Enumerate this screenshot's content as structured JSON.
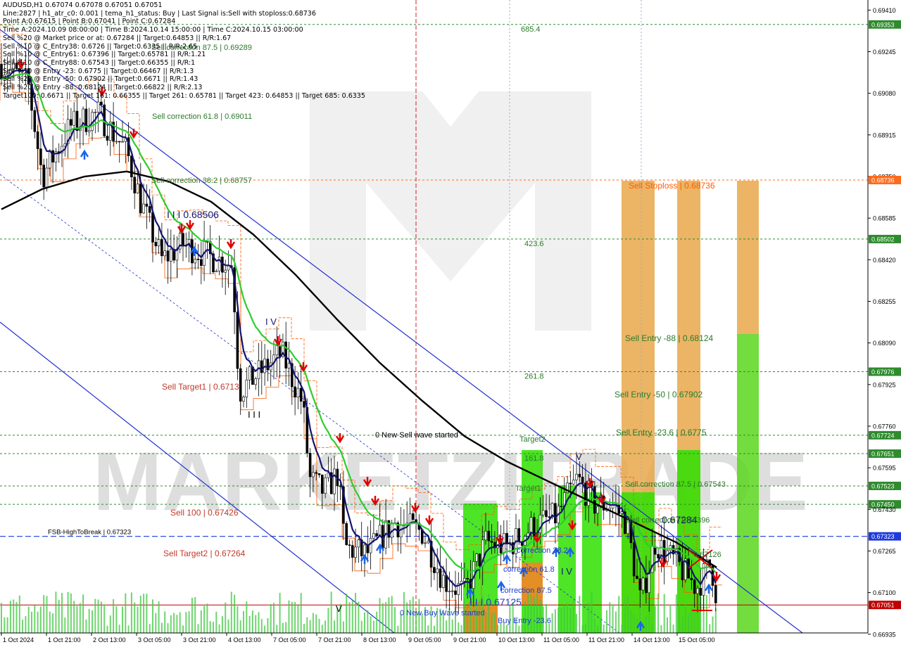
{
  "header": {
    "lines": [
      "AUDUSD,H1  0.67074 0.67078 0.67051 0.67051",
      "Line:2827  | h1_atr_c0: 0.001  | tema_h1_status: Buy  | Last Signal is:Sell with stoploss:0.68736",
      "Point A:0.67615 | Point B:0.67041 | Point C:0.67284",
      "Time A:2024.10.09 08:00:00 | Time B:2024.10.14 15:00:00 | Time C:2024.10.15 03:00:00",
      "Sell %20 @ Market price or at: 0.67284 || Target:0.64853 || R/R:1.67",
      "Sell %10 @ C_Entry38: 0.6726 || Target:0.6335 || R/R:2.65",
      "Sell %10 @ C_Entry61: 0.67396 || Target:0.65781 || R/R:1.21",
      "Sell %10 @ C_Entry88: 0.67543 || Target:0.66355 || R/R:1",
      "Sell %10 @ Entry -23: 0.6775 || Target:0.66467 || R/R:1.3",
      "Sell %20 @ Entry -50: 0.67902 || Target:0.6671 || R/R:1.43",
      "Sell %20 @ Entry -88: 0.68124 || Target:0.66822 || R/R:2.13",
      "Target100: 0.6671 || Target 161: 0.66355 || Target 261: 0.65781 || Target 423: 0.64853 || Target 685: 0.6335"
    ]
  },
  "chart_data": {
    "type": "candlestick",
    "symbol": "AUDUSD",
    "timeframe": "H1",
    "ylim": [
      0.6694,
      0.6945
    ],
    "price_ticks": [
      "0.69410",
      "0.69353",
      "0.69245",
      "0.69080",
      "0.68915",
      "0.68750",
      "0.68736",
      "0.68585",
      "0.68502",
      "0.68420",
      "0.68255",
      "0.68090",
      "0.67976",
      "0.67925",
      "0.67760",
      "0.67724",
      "0.67651",
      "0.67595",
      "0.67523",
      "0.67450",
      "0.67430",
      "0.67323",
      "0.67265",
      "0.67100",
      "0.67051",
      "0.66935"
    ],
    "x_ticks": [
      "1 Oct 2024",
      "1 Oct 21:00",
      "2 Oct 13:00",
      "3 Oct 05:00",
      "3 Oct 21:00",
      "4 Oct 13:00",
      "7 Oct 05:00",
      "7 Oct 21:00",
      "8 Oct 13:00",
      "9 Oct 05:00",
      "9 Oct 21:00",
      "10 Oct 13:00",
      "11 Oct 05:00",
      "11 Oct 21:00",
      "14 Oct 13:00",
      "15 Oct 05:00"
    ],
    "hlines": [
      {
        "price": 0.69353,
        "color": "#2e8b2e",
        "tag": "0.69353",
        "label": "685.4"
      },
      {
        "price": 0.68736,
        "color": "#ff6a1a",
        "tag": "0.68736",
        "label": ""
      },
      {
        "price": 0.68502,
        "color": "#2e8b2e",
        "tag": "0.68502",
        "label": "423.6"
      },
      {
        "price": 0.67976,
        "color": "#2e8b2e",
        "tag": "0.67976",
        "label": "261.8"
      },
      {
        "price": 0.67724,
        "color": "#2e8b2e",
        "tag": "0.67724",
        "label": ""
      },
      {
        "price": 0.67651,
        "color": "#2e8b2e",
        "tag": "0.67651",
        "label": "161.8"
      },
      {
        "price": 0.67523,
        "color": "#2e8b2e",
        "tag": "0.67523",
        "label": ""
      },
      {
        "price": 0.6745,
        "color": "#2e8b2e",
        "tag": "0.67450",
        "label": ""
      },
      {
        "price": 0.67323,
        "color": "#1f3bdb",
        "tag": "0.67323",
        "label": "FSB-HighToBreak | 0.67323"
      },
      {
        "price": 0.67051,
        "color": "#c00000",
        "tag": "0.67051",
        "label": ""
      }
    ],
    "annotations": [
      "Sell correction 87.5 | 0.69289",
      "Sell correction 61.8 | 0.69011",
      "Sell correction 38.2 | 0.68757",
      "I I I 0.68506",
      "Sell Target1 | 0.6713",
      "Sell 100 | 0.67426",
      "Sell Target2 | 0.67264",
      "0 New Sell wave started",
      "0 New Buy Wave started",
      "Target2",
      "Target1",
      "I I I 0.67125",
      "correction 38.2",
      "correction 61.8",
      "correction 87.5",
      "Buy Entry -23.6",
      "Sell Stoploss | 0.68736",
      "Sell Entry -88 | 0.68124",
      "Sell Entry -50 | 0.67902",
      "Sell Entry -23.6 | 0.6775",
      "Sell correction 87.5 | 0.67543",
      "0.67284",
      "Sell correction | 0.67396",
      "0.67126",
      "I V",
      "V",
      "I I I",
      "I V",
      "V"
    ],
    "watermark": "MARKETZITRADE"
  }
}
